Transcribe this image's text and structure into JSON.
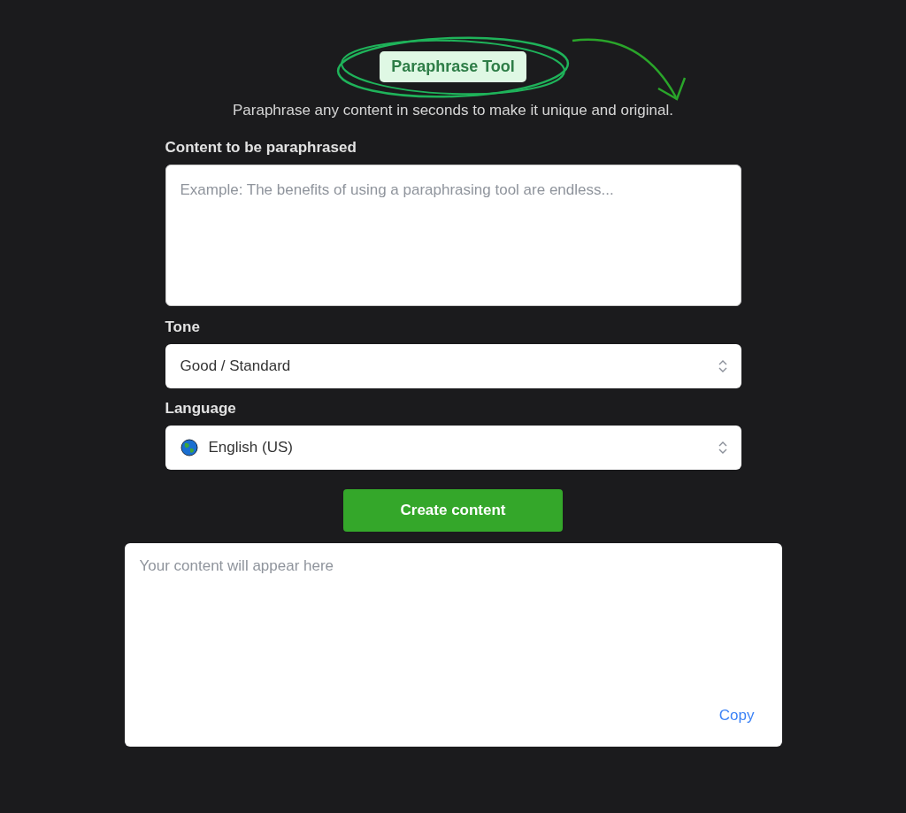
{
  "badge": "Paraphrase Tool",
  "subtitle": "Paraphrase any content in seconds to make it unique and original.",
  "content_field": {
    "label": "Content to be paraphrased",
    "placeholder": "Example: The benefits of using a paraphrasing tool are endless..."
  },
  "tone": {
    "label": "Tone",
    "value": "Good / Standard"
  },
  "language": {
    "label": "Language",
    "value": "English (US)"
  },
  "button": "Create content",
  "output": {
    "placeholder": "Your content will appear here",
    "copy": "Copy"
  }
}
